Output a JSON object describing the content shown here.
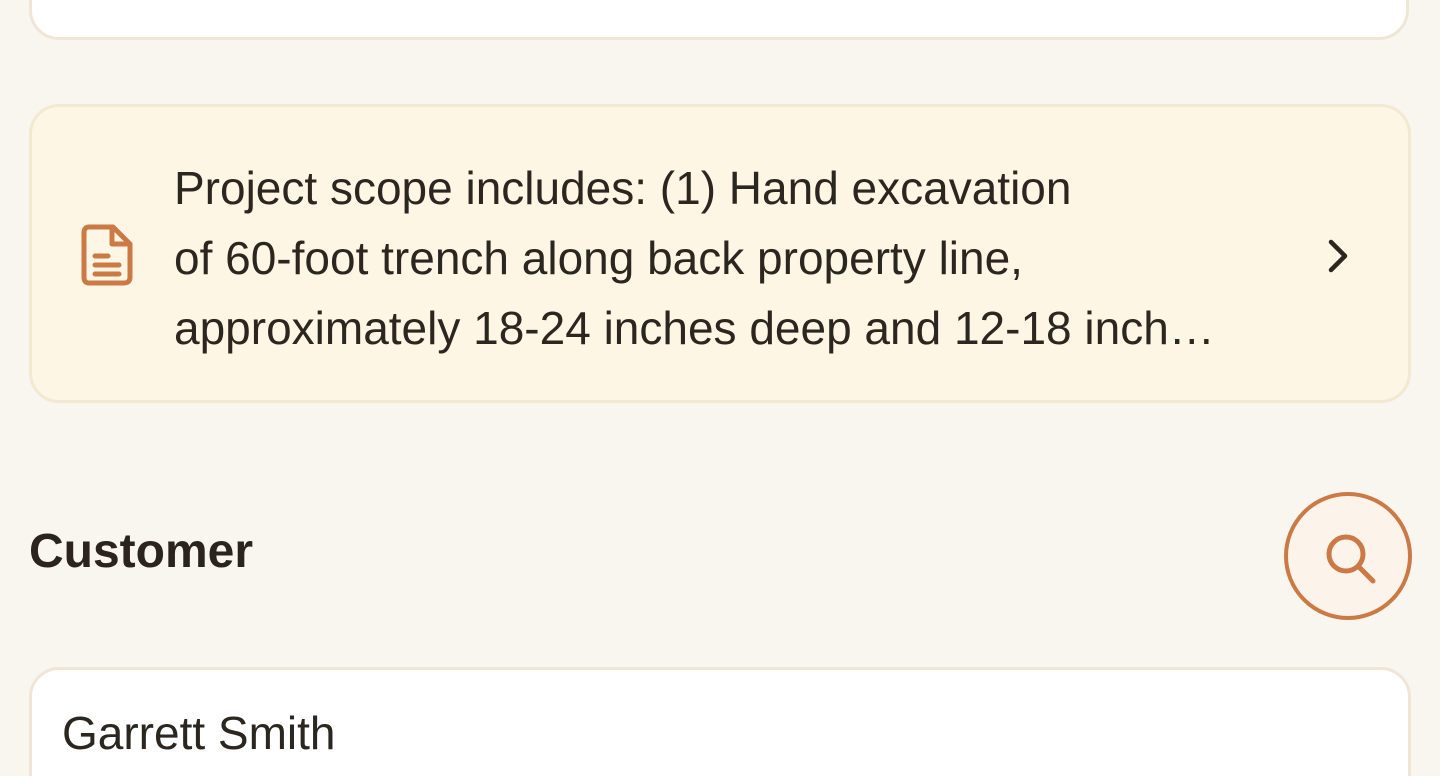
{
  "scope": {
    "icon": "document-icon",
    "text": "Project scope includes: (1) Hand excavation\nof 60-foot trench along back property line,\napproximately 18-24 inches deep and 12-18 inch…",
    "chevron_icon": "chevron-right-icon"
  },
  "customer": {
    "section_title": "Customer",
    "search_icon": "search-icon",
    "value": "Garrett Smith"
  },
  "colors": {
    "background": "#f9f5ef",
    "scope_card_bg": "#fdf6e4",
    "accent": "#cc7a45",
    "text": "#2c2620"
  }
}
